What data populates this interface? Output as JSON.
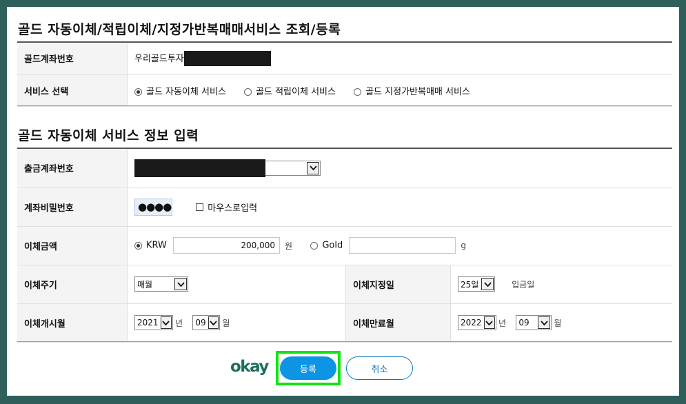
{
  "section1": {
    "title": "골드 자동이체/적립이체/지정가반복매매서비스 조회/등록",
    "account_label": "골드계좌번호",
    "account_value_prefix": "우리골드투자",
    "service_label": "서비스 선택",
    "service_options": [
      {
        "label": "골드 자동이체 서비스",
        "selected": true
      },
      {
        "label": "골드 적립이체 서비스",
        "selected": false
      },
      {
        "label": "골드 지정가반복매매 서비스",
        "selected": false
      }
    ]
  },
  "section2": {
    "title": "골드 자동이체 서비스 정보 입력",
    "withdraw_account_label": "출금계좌번호",
    "password_label": "계좌비밀번호",
    "password_mask": "●●●●",
    "mouse_input_label": "마우스로입력",
    "amount_label": "이체금액",
    "krw_label": "KRW",
    "krw_value": "200,000",
    "krw_unit": "원",
    "gold_label": "Gold",
    "gold_value": "",
    "gold_unit": "g",
    "cycle_label": "이체주기",
    "cycle_value": "매월",
    "day_label": "이체지정일",
    "day_value": "25일",
    "day_note": "입금일",
    "start_label": "이체개시월",
    "start_year": "2021",
    "start_year_unit": "년",
    "start_month": "09",
    "start_month_unit": "월",
    "end_label": "이체만료월",
    "end_year": "2022",
    "end_year_unit": "년",
    "end_month": "09",
    "end_month_unit": "월"
  },
  "footer": {
    "logo_text": "okay",
    "register_label": "등록",
    "cancel_label": "취소"
  },
  "colors": {
    "background": "#2f5f5a",
    "primary_button": "#0d94e4",
    "highlight": "#13e313",
    "logo": "#1e6e5c"
  }
}
